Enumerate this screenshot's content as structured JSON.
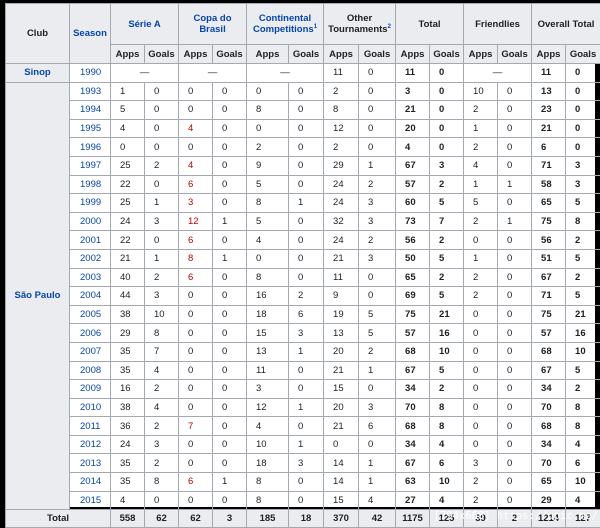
{
  "headers": {
    "club": "Club",
    "season": "Season",
    "serie_a": "Série A",
    "copa_line1": "Copa do",
    "copa_line2": "Brasil",
    "continental_line1": "Continental",
    "continental_line2": "Competitions",
    "continental_sup": "1",
    "other_line1": "Other",
    "other_line2": "Tournaments",
    "other_sup": "2",
    "total": "Total",
    "friendlies": "Friendlies",
    "overall": "Overall Total",
    "apps": "Apps",
    "goals": "Goals"
  },
  "sinop": {
    "club": "Sinop",
    "season": "1990",
    "serie_a": "—",
    "copa": "—",
    "continental": "—",
    "other_apps": "11",
    "other_goals": "0",
    "total_apps": "11",
    "total_goals": "0",
    "friendlies": "—",
    "overall_apps": "11",
    "overall_goals": "0"
  },
  "sao_paulo": {
    "club": "São Paulo",
    "rows": [
      [
        "1993",
        "1",
        "0",
        "0",
        "0",
        "0",
        "0",
        "2",
        "0",
        "3",
        "0",
        "10",
        "0",
        "13",
        "0"
      ],
      [
        "1994",
        "5",
        "0",
        "0",
        "0",
        "8",
        "0",
        "8",
        "0",
        "21",
        "0",
        "2",
        "0",
        "23",
        "0"
      ],
      [
        "1995",
        "4",
        "0",
        "4",
        "0",
        "0",
        "0",
        "12",
        "0",
        "20",
        "0",
        "1",
        "0",
        "21",
        "0"
      ],
      [
        "1996",
        "0",
        "0",
        "0",
        "0",
        "2",
        "0",
        "2",
        "0",
        "4",
        "0",
        "2",
        "0",
        "6",
        "0"
      ],
      [
        "1997",
        "25",
        "2",
        "4",
        "0",
        "9",
        "0",
        "29",
        "1",
        "67",
        "3",
        "4",
        "0",
        "71",
        "3"
      ],
      [
        "1998",
        "22",
        "0",
        "6",
        "0",
        "5",
        "0",
        "24",
        "2",
        "57",
        "2",
        "1",
        "1",
        "58",
        "3"
      ],
      [
        "1999",
        "25",
        "1",
        "3",
        "0",
        "8",
        "1",
        "24",
        "3",
        "60",
        "5",
        "5",
        "0",
        "65",
        "5"
      ],
      [
        "2000",
        "24",
        "3",
        "12",
        "1",
        "5",
        "0",
        "32",
        "3",
        "73",
        "7",
        "2",
        "1",
        "75",
        "8"
      ],
      [
        "2001",
        "22",
        "0",
        "6",
        "0",
        "4",
        "0",
        "24",
        "2",
        "56",
        "2",
        "0",
        "0",
        "56",
        "2"
      ],
      [
        "2002",
        "21",
        "1",
        "8",
        "1",
        "0",
        "0",
        "21",
        "3",
        "50",
        "5",
        "1",
        "0",
        "51",
        "5"
      ],
      [
        "2003",
        "40",
        "2",
        "6",
        "0",
        "8",
        "0",
        "11",
        "0",
        "65",
        "2",
        "2",
        "0",
        "67",
        "2"
      ],
      [
        "2004",
        "44",
        "3",
        "0",
        "0",
        "16",
        "2",
        "9",
        "0",
        "69",
        "5",
        "2",
        "0",
        "71",
        "5"
      ],
      [
        "2005",
        "38",
        "10",
        "0",
        "0",
        "18",
        "6",
        "19",
        "5",
        "75",
        "21",
        "0",
        "0",
        "75",
        "21"
      ],
      [
        "2006",
        "29",
        "8",
        "0",
        "0",
        "15",
        "3",
        "13",
        "5",
        "57",
        "16",
        "0",
        "0",
        "57",
        "16"
      ],
      [
        "2007",
        "35",
        "7",
        "0",
        "0",
        "13",
        "1",
        "20",
        "2",
        "68",
        "10",
        "0",
        "0",
        "68",
        "10"
      ],
      [
        "2008",
        "35",
        "4",
        "0",
        "0",
        "11",
        "0",
        "21",
        "1",
        "67",
        "5",
        "0",
        "0",
        "67",
        "5"
      ],
      [
        "2009",
        "16",
        "2",
        "0",
        "0",
        "3",
        "0",
        "15",
        "0",
        "34",
        "2",
        "0",
        "0",
        "34",
        "2"
      ],
      [
        "2010",
        "38",
        "4",
        "0",
        "0",
        "12",
        "1",
        "20",
        "3",
        "70",
        "8",
        "0",
        "0",
        "70",
        "8"
      ],
      [
        "2011",
        "36",
        "2",
        "7",
        "0",
        "4",
        "0",
        "21",
        "6",
        "68",
        "8",
        "0",
        "0",
        "68",
        "8"
      ],
      [
        "2012",
        "24",
        "3",
        "0",
        "0",
        "10",
        "1",
        "0",
        "0",
        "34",
        "4",
        "0",
        "0",
        "34",
        "4"
      ],
      [
        "2013",
        "35",
        "2",
        "0",
        "0",
        "18",
        "3",
        "14",
        "1",
        "67",
        "6",
        "3",
        "0",
        "70",
        "6"
      ],
      [
        "2014",
        "35",
        "8",
        "6",
        "1",
        "8",
        "0",
        "14",
        "1",
        "63",
        "10",
        "2",
        "0",
        "65",
        "10"
      ],
      [
        "2015",
        "4",
        "0",
        "0",
        "0",
        "8",
        "0",
        "15",
        "4",
        "27",
        "4",
        "2",
        "0",
        "29",
        "4"
      ]
    ]
  },
  "total_row": [
    "Total",
    "558",
    "62",
    "62",
    "3",
    "185",
    "18",
    "370",
    "42",
    "1175",
    "125",
    "39",
    "2",
    "1214",
    "127"
  ],
  "watermark": "[794x668] https://upic.me/"
}
